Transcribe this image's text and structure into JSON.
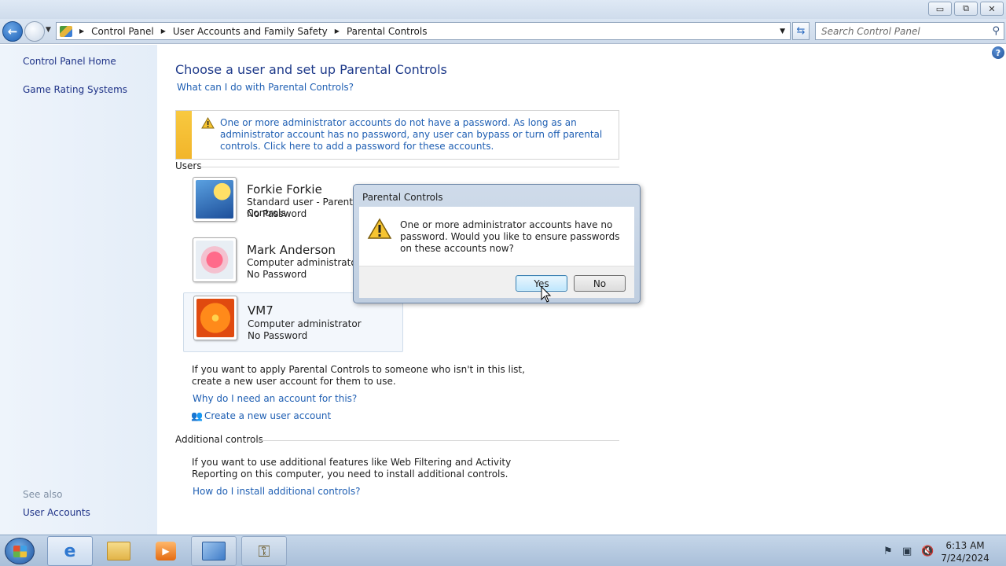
{
  "window": {
    "controls": {
      "minimize": "▭",
      "maximize": "⧉",
      "close": "✕"
    }
  },
  "address": {
    "crumbs": [
      "Control Panel",
      "User Accounts and Family Safety",
      "Parental Controls"
    ],
    "search_placeholder": "Search Control Panel"
  },
  "sidebar": {
    "items": [
      "Control Panel Home",
      "Game Rating Systems"
    ],
    "see_also_label": "See also",
    "see_also_items": [
      "User Accounts"
    ]
  },
  "main": {
    "title": "Choose a user and set up Parental Controls",
    "help_link": "What can I do with Parental Controls?",
    "warning": "One or more administrator accounts do not have a password. As long as an administrator account has no password, any user can bypass or turn off parental controls. Click here to add a password for these accounts.",
    "users_label": "Users",
    "users": [
      {
        "name": "Forkie Forkie",
        "role": "Standard user - Parental Controls",
        "password": "No Password",
        "avatar": "leaf"
      },
      {
        "name": "Mark Anderson",
        "role": "Computer administrator",
        "password": "No Password",
        "avatar": "star"
      },
      {
        "name": "VM7",
        "role": "Computer administrator",
        "password": "No Password",
        "avatar": "flower"
      }
    ],
    "apply_text_1": "If you want to apply Parental Controls to someone who isn't in this list,",
    "apply_text_2": "create a new user account for them to use.",
    "why_link": "Why do I need an account for this?",
    "create_link": "Create a new user account",
    "additional_label": "Additional controls",
    "additional_text_1": "If you want to use additional features like Web Filtering and Activity",
    "additional_text_2": "Reporting on this computer, you need to install additional controls.",
    "install_link": "How do I install additional controls?"
  },
  "dialog": {
    "title": "Parental Controls",
    "message": "One or more administrator accounts have no password. Would you like to ensure passwords on these accounts now?",
    "yes_label": "Yes",
    "no_label": "No"
  },
  "taskbar": {
    "time": "6:13 AM",
    "date": "7/24/2024"
  },
  "colors": {
    "link": "#1f5fb3",
    "heading": "#1e3a8a",
    "warning_bar": "#f2b52a"
  }
}
